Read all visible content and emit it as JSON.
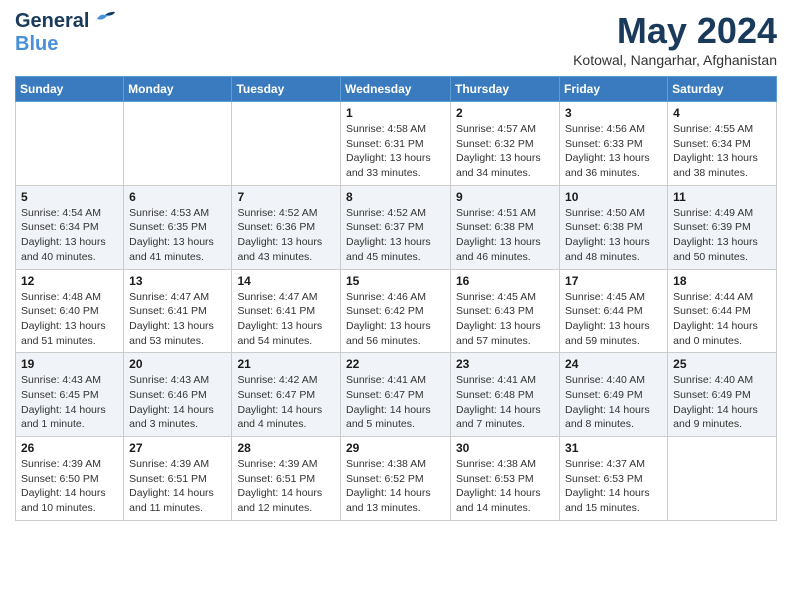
{
  "header": {
    "logo_general": "General",
    "logo_blue": "Blue",
    "month_year": "May 2024",
    "location": "Kotowal, Nangarhar, Afghanistan"
  },
  "weekdays": [
    "Sunday",
    "Monday",
    "Tuesday",
    "Wednesday",
    "Thursday",
    "Friday",
    "Saturday"
  ],
  "weeks": [
    [
      {
        "day": "",
        "info": ""
      },
      {
        "day": "",
        "info": ""
      },
      {
        "day": "",
        "info": ""
      },
      {
        "day": "1",
        "info": "Sunrise: 4:58 AM\nSunset: 6:31 PM\nDaylight: 13 hours\nand 33 minutes."
      },
      {
        "day": "2",
        "info": "Sunrise: 4:57 AM\nSunset: 6:32 PM\nDaylight: 13 hours\nand 34 minutes."
      },
      {
        "day": "3",
        "info": "Sunrise: 4:56 AM\nSunset: 6:33 PM\nDaylight: 13 hours\nand 36 minutes."
      },
      {
        "day": "4",
        "info": "Sunrise: 4:55 AM\nSunset: 6:34 PM\nDaylight: 13 hours\nand 38 minutes."
      }
    ],
    [
      {
        "day": "5",
        "info": "Sunrise: 4:54 AM\nSunset: 6:34 PM\nDaylight: 13 hours\nand 40 minutes."
      },
      {
        "day": "6",
        "info": "Sunrise: 4:53 AM\nSunset: 6:35 PM\nDaylight: 13 hours\nand 41 minutes."
      },
      {
        "day": "7",
        "info": "Sunrise: 4:52 AM\nSunset: 6:36 PM\nDaylight: 13 hours\nand 43 minutes."
      },
      {
        "day": "8",
        "info": "Sunrise: 4:52 AM\nSunset: 6:37 PM\nDaylight: 13 hours\nand 45 minutes."
      },
      {
        "day": "9",
        "info": "Sunrise: 4:51 AM\nSunset: 6:38 PM\nDaylight: 13 hours\nand 46 minutes."
      },
      {
        "day": "10",
        "info": "Sunrise: 4:50 AM\nSunset: 6:38 PM\nDaylight: 13 hours\nand 48 minutes."
      },
      {
        "day": "11",
        "info": "Sunrise: 4:49 AM\nSunset: 6:39 PM\nDaylight: 13 hours\nand 50 minutes."
      }
    ],
    [
      {
        "day": "12",
        "info": "Sunrise: 4:48 AM\nSunset: 6:40 PM\nDaylight: 13 hours\nand 51 minutes."
      },
      {
        "day": "13",
        "info": "Sunrise: 4:47 AM\nSunset: 6:41 PM\nDaylight: 13 hours\nand 53 minutes."
      },
      {
        "day": "14",
        "info": "Sunrise: 4:47 AM\nSunset: 6:41 PM\nDaylight: 13 hours\nand 54 minutes."
      },
      {
        "day": "15",
        "info": "Sunrise: 4:46 AM\nSunset: 6:42 PM\nDaylight: 13 hours\nand 56 minutes."
      },
      {
        "day": "16",
        "info": "Sunrise: 4:45 AM\nSunset: 6:43 PM\nDaylight: 13 hours\nand 57 minutes."
      },
      {
        "day": "17",
        "info": "Sunrise: 4:45 AM\nSunset: 6:44 PM\nDaylight: 13 hours\nand 59 minutes."
      },
      {
        "day": "18",
        "info": "Sunrise: 4:44 AM\nSunset: 6:44 PM\nDaylight: 14 hours\nand 0 minutes."
      }
    ],
    [
      {
        "day": "19",
        "info": "Sunrise: 4:43 AM\nSunset: 6:45 PM\nDaylight: 14 hours\nand 1 minute."
      },
      {
        "day": "20",
        "info": "Sunrise: 4:43 AM\nSunset: 6:46 PM\nDaylight: 14 hours\nand 3 minutes."
      },
      {
        "day": "21",
        "info": "Sunrise: 4:42 AM\nSunset: 6:47 PM\nDaylight: 14 hours\nand 4 minutes."
      },
      {
        "day": "22",
        "info": "Sunrise: 4:41 AM\nSunset: 6:47 PM\nDaylight: 14 hours\nand 5 minutes."
      },
      {
        "day": "23",
        "info": "Sunrise: 4:41 AM\nSunset: 6:48 PM\nDaylight: 14 hours\nand 7 minutes."
      },
      {
        "day": "24",
        "info": "Sunrise: 4:40 AM\nSunset: 6:49 PM\nDaylight: 14 hours\nand 8 minutes."
      },
      {
        "day": "25",
        "info": "Sunrise: 4:40 AM\nSunset: 6:49 PM\nDaylight: 14 hours\nand 9 minutes."
      }
    ],
    [
      {
        "day": "26",
        "info": "Sunrise: 4:39 AM\nSunset: 6:50 PM\nDaylight: 14 hours\nand 10 minutes."
      },
      {
        "day": "27",
        "info": "Sunrise: 4:39 AM\nSunset: 6:51 PM\nDaylight: 14 hours\nand 11 minutes."
      },
      {
        "day": "28",
        "info": "Sunrise: 4:39 AM\nSunset: 6:51 PM\nDaylight: 14 hours\nand 12 minutes."
      },
      {
        "day": "29",
        "info": "Sunrise: 4:38 AM\nSunset: 6:52 PM\nDaylight: 14 hours\nand 13 minutes."
      },
      {
        "day": "30",
        "info": "Sunrise: 4:38 AM\nSunset: 6:53 PM\nDaylight: 14 hours\nand 14 minutes."
      },
      {
        "day": "31",
        "info": "Sunrise: 4:37 AM\nSunset: 6:53 PM\nDaylight: 14 hours\nand 15 minutes."
      },
      {
        "day": "",
        "info": ""
      }
    ]
  ]
}
